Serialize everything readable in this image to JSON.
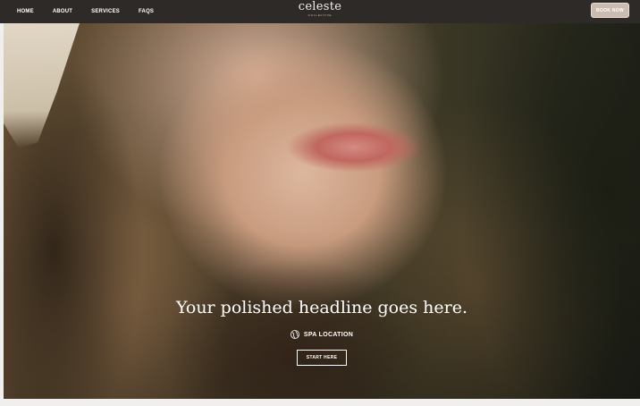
{
  "nav": {
    "links": [
      "HOME",
      "ABOUT",
      "SERVICES",
      "FAQS"
    ],
    "logo": "celeste",
    "logo_sub": "COLLECTIVE",
    "book_label": "BOOK NOW"
  },
  "hero": {
    "headline": "Your polished headline goes here.",
    "location_icon": "globe-icon",
    "location": "SPA LOCATION",
    "cta_label": "START HERE"
  },
  "colors": {
    "nav_bg": "#2e2a28",
    "book_button_bg": "#cbbcb2",
    "page_bg": "#f1eeee"
  }
}
